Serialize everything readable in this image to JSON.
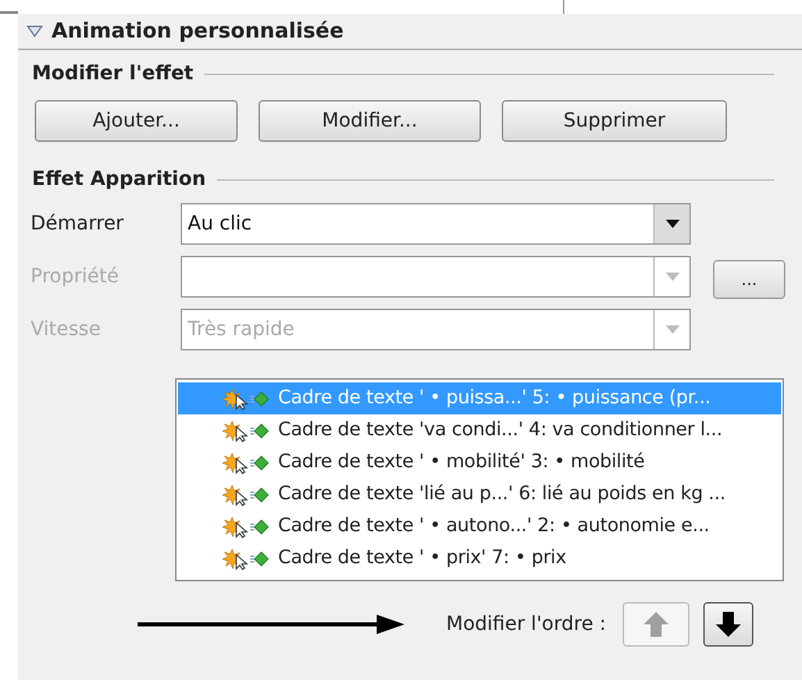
{
  "panel": {
    "title": "Animation personnalisée",
    "expanded": true
  },
  "modify_effect": {
    "heading": "Modifier l'effet",
    "buttons": [
      "Ajouter...",
      "Modifier...",
      "Supprimer"
    ]
  },
  "effect": {
    "heading": "Effet Apparition",
    "fields": [
      {
        "label": "Démarrer",
        "value": "Au clic",
        "disabled": false
      },
      {
        "label": "Propriété",
        "disabled": true,
        "options_button": "..."
      },
      {
        "label": "Vitesse",
        "value": "Très rapide",
        "disabled": true
      }
    ]
  },
  "animations": [
    {
      "text": "Cadre de texte ' • puissa...' 5: • puissance (pr...",
      "selected": true
    },
    {
      "text": "Cadre de texte 'va condi...' 4: va conditionner l...",
      "selected": false
    },
    {
      "text": "Cadre de texte ' • mobilité' 3: • mobilité",
      "selected": false
    },
    {
      "text": "Cadre de texte 'lié au p...' 6: lié au poids en kg ...",
      "selected": false
    },
    {
      "text": "Cadre de texte ' • autono...' 2: • autonomie e...",
      "selected": false
    },
    {
      "text": "Cadre de texte ' • prix' 7: • prix",
      "selected": false
    }
  ],
  "order": {
    "label": "Modifier l'ordre :",
    "up_disabled": true,
    "down_disabled": false
  }
}
